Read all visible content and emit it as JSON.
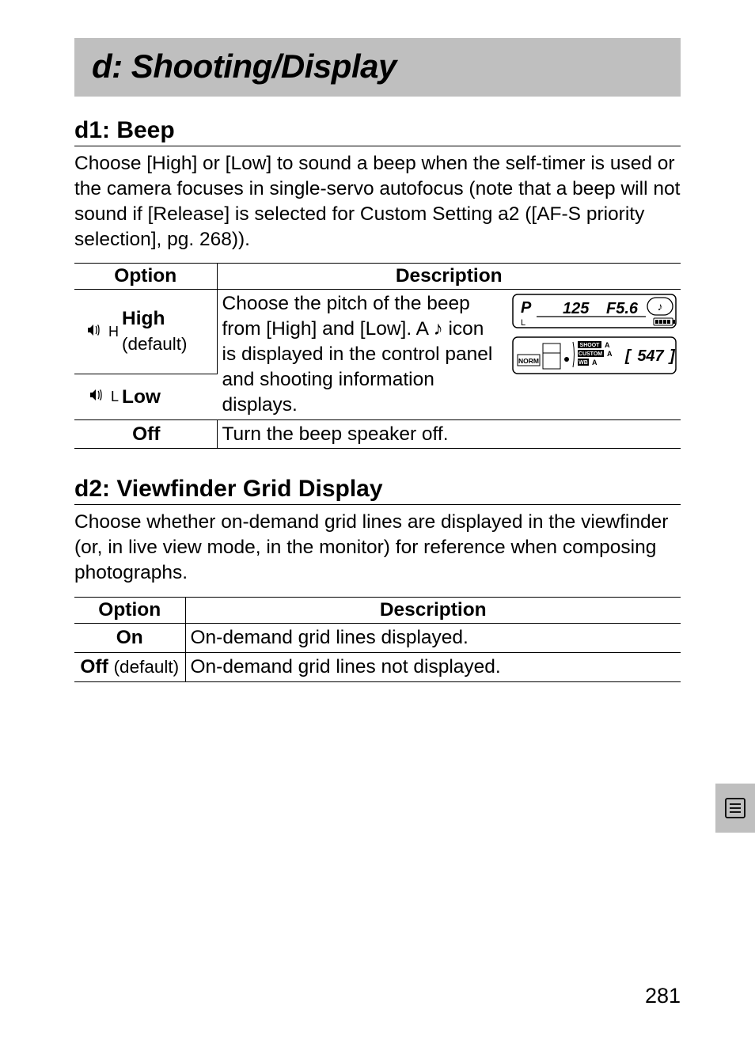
{
  "section_title": "d: Shooting/Display",
  "d1": {
    "heading": "d1: Beep",
    "intro": "Choose [High] or [Low] to sound a beep when the self-timer is used or the camera focuses in single-servo autofocus (note that a beep will not sound if [Release] is selected for Custom Setting a2 ([AF-S priority selection], pg. 268)).",
    "th_option": "Option",
    "th_desc": "Description",
    "row_high": {
      "icon_level": "H",
      "label": "High",
      "sub": "(default)"
    },
    "row_low": {
      "icon_level": "L",
      "label": "Low"
    },
    "desc_hl_before": "Choose the pitch of the beep from [High] and [Low].  A ",
    "desc_hl_after": " icon is displayed in the control panel and shooting information displays.",
    "row_off_label": "Off",
    "row_off_desc": "Turn the beep speaker off.",
    "lcd": {
      "mode": "P",
      "shutter": "125",
      "aperture": "F5.6",
      "size": "L",
      "qual": "NORM",
      "shoot": "SHOOT",
      "shoot_suffix": "A",
      "custom": "CUSTOM",
      "custom_suffix": "A",
      "wb": "WB",
      "wb_suffix": "A",
      "count": "547"
    }
  },
  "d2": {
    "heading": "d2: Viewfinder Grid Display",
    "intro": "Choose whether on-demand grid lines are displayed in the viewfinder (or, in live view mode, in the monitor) for reference when composing photographs.",
    "th_option": "Option",
    "th_desc": "Description",
    "row_on_label": "On",
    "row_on_desc": "On-demand grid lines displayed.",
    "row_off_label": "Off",
    "row_off_default": "(default)",
    "row_off_desc": "On-demand grid lines not displayed."
  },
  "page_number": "281"
}
